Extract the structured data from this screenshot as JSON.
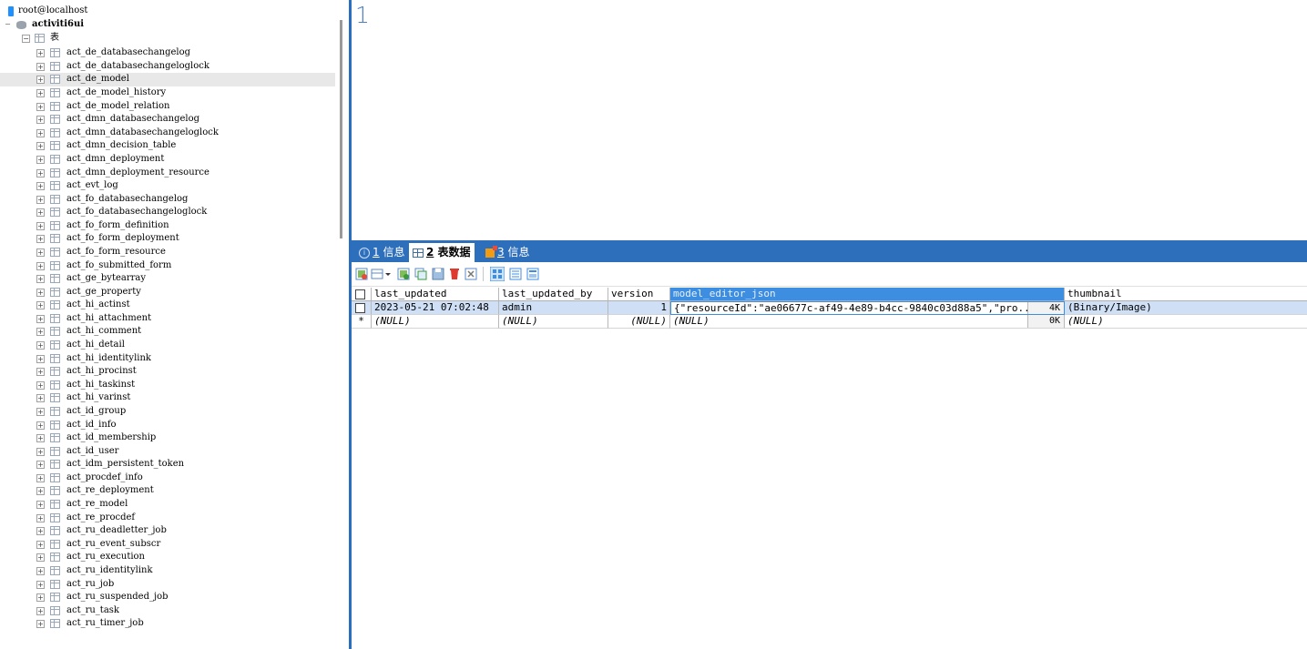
{
  "tree": {
    "connection": "root@localhost",
    "database": "activiti6ui",
    "tables_folder": "表",
    "tables": [
      "act_de_databasechangelog",
      "act_de_databasechangeloglock",
      "act_de_model",
      "act_de_model_history",
      "act_de_model_relation",
      "act_dmn_databasechangelog",
      "act_dmn_databasechangeloglock",
      "act_dmn_decision_table",
      "act_dmn_deployment",
      "act_dmn_deployment_resource",
      "act_evt_log",
      "act_fo_databasechangelog",
      "act_fo_databasechangeloglock",
      "act_fo_form_definition",
      "act_fo_form_deployment",
      "act_fo_form_resource",
      "act_fo_submitted_form",
      "act_ge_bytearray",
      "act_ge_property",
      "act_hi_actinst",
      "act_hi_attachment",
      "act_hi_comment",
      "act_hi_detail",
      "act_hi_identitylink",
      "act_hi_procinst",
      "act_hi_taskinst",
      "act_hi_varinst",
      "act_id_group",
      "act_id_info",
      "act_id_membership",
      "act_id_user",
      "act_idm_persistent_token",
      "act_procdef_info",
      "act_re_deployment",
      "act_re_model",
      "act_re_procdef",
      "act_ru_deadletter_job",
      "act_ru_event_subscr",
      "act_ru_execution",
      "act_ru_identitylink",
      "act_ru_job",
      "act_ru_suspended_job",
      "act_ru_task",
      "act_ru_timer_job"
    ],
    "selected_table": "act_de_model"
  },
  "editor": {
    "line_number": "1"
  },
  "result_tabs": [
    {
      "num": "1",
      "label": "信息",
      "icon": "info-icon"
    },
    {
      "num": "2",
      "label": "表数据",
      "icon": "table-grid-icon"
    },
    {
      "num": "3",
      "label": "信息",
      "icon": "warning-icon"
    }
  ],
  "grid": {
    "columns": [
      "last_updated",
      "last_updated_by",
      "version",
      "model_editor_json",
      "thumbnail"
    ],
    "rows": [
      {
        "marker": "",
        "last_updated": "2023-05-21 07:02:48",
        "last_updated_by": "admin",
        "version": "1",
        "model_editor_json": "{\"resourceId\":\"ae06677c-af49-4e89-b4cc-9840c03d88a5\",\"pro...",
        "json_size": "4K",
        "thumbnail": "(Binary/Image)"
      },
      {
        "marker": "*",
        "last_updated": "(NULL)",
        "last_updated_by": "(NULL)",
        "version": "(NULL)",
        "model_editor_json": "(NULL)",
        "json_size": "0K",
        "thumbnail": "(NULL)"
      }
    ]
  },
  "colors": {
    "accent": "#2e6fbb",
    "header_selected": "#3d8de0",
    "row_selected": "#cfe0f6"
  }
}
